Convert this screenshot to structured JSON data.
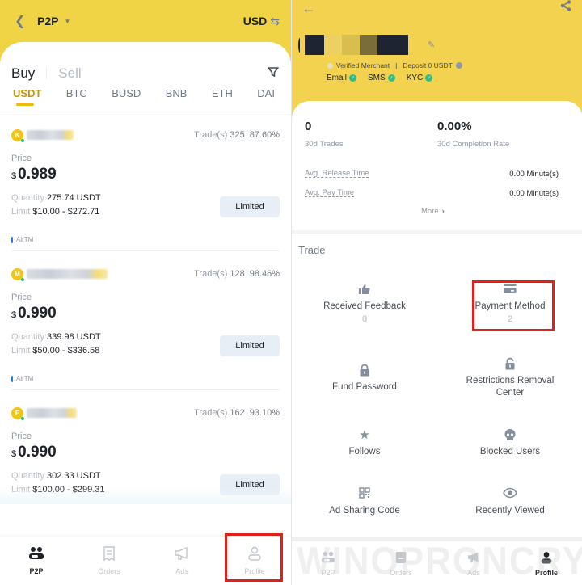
{
  "left": {
    "header": {
      "back_icon": "chevron-left-icon",
      "title": "P2P",
      "title_caret": "caret-down-icon",
      "currency": "USD",
      "swap_icon": "swap-icon"
    },
    "tabs": {
      "buy": "Buy",
      "sell": "Sell",
      "active": "Buy"
    },
    "filter_icon": "filter-icon",
    "coins": [
      "USDT",
      "BTC",
      "BUSD",
      "BNB",
      "ETH",
      "DAI"
    ],
    "active_coin": "USDT",
    "ads": [
      {
        "avatar_letter": "K",
        "trades_label": "Trade(s)",
        "trades": "325",
        "completion": "87.60%",
        "price_label": "Price",
        "currency_symbol": "$",
        "price": "0.989",
        "quantity_label": "Quantity",
        "quantity": "275.74 USDT",
        "limit_label": "Limit",
        "limit": "$10.00 - $272.71",
        "button": "Limited",
        "payment": "AirTM"
      },
      {
        "avatar_letter": "M",
        "trades_label": "Trade(s)",
        "trades": "128",
        "completion": "98.46%",
        "price_label": "Price",
        "currency_symbol": "$",
        "price": "0.990",
        "quantity_label": "Quantity",
        "quantity": "339.98 USDT",
        "limit_label": "Limit",
        "limit": "$50.00 - $336.58",
        "button": "Limited",
        "payment": "AirTM"
      },
      {
        "avatar_letter": "E",
        "trades_label": "Trade(s)",
        "trades": "162",
        "completion": "93.10%",
        "price_label": "Price",
        "currency_symbol": "$",
        "price": "0.990",
        "quantity_label": "Quantity",
        "quantity": "302.33 USDT",
        "limit_label": "Limit",
        "limit": "$100.00 - $299.31",
        "button": "Limited",
        "payment": "AirTM"
      }
    ],
    "bottom_nav": [
      {
        "label": "P2P",
        "icon": "p2p-icon",
        "active": true
      },
      {
        "label": "Orders",
        "icon": "orders-icon",
        "active": false
      },
      {
        "label": "Ads",
        "icon": "megaphone-icon",
        "active": false
      },
      {
        "label": "Profile",
        "icon": "profile-icon",
        "active": false,
        "highlighted": true
      }
    ]
  },
  "right": {
    "header": {
      "back_icon": "arrow-left-icon",
      "share_icon": "share-icon"
    },
    "profile": {
      "edit_icon": "edit-icon",
      "merchant_label": "Verified Merchant",
      "deposit_label": "Deposit 0 USDT",
      "verifications": [
        "Email",
        "SMS",
        "KYC"
      ]
    },
    "stats": {
      "trades_value": "0",
      "trades_label": "30d Trades",
      "completion_value": "0.00%",
      "completion_label": "30d Completion Rate",
      "release_label": "Avg. Release Time",
      "release_value": "0.00 Minute(s)",
      "pay_label": "Avg. Pay Time",
      "pay_value": "0.00 Minute(s)",
      "more": "More"
    },
    "trade_section": {
      "title": "Trade",
      "items": [
        {
          "label": "Received Feedback",
          "count": "0",
          "icon": "thumbs-up-icon"
        },
        {
          "label": "Payment Method",
          "count": "2",
          "icon": "card-icon",
          "highlighted": true
        },
        {
          "label": "Fund Password",
          "icon": "lock-icon"
        },
        {
          "label": "Restrictions Removal Center",
          "icon": "unlock-icon"
        },
        {
          "label": "Follows",
          "icon": "star-icon"
        },
        {
          "label": "Blocked Users",
          "icon": "blocked-user-icon"
        },
        {
          "label": "Ad Sharing Code",
          "icon": "qr-code-icon"
        },
        {
          "label": "Recently Viewed",
          "icon": "eye-icon"
        }
      ]
    },
    "bottom_nav": [
      {
        "label": "P2P",
        "icon": "p2p-icon",
        "active": false
      },
      {
        "label": "Orders",
        "icon": "orders-icon",
        "active": false
      },
      {
        "label": "Ads",
        "icon": "megaphone-icon",
        "active": false
      },
      {
        "label": "Profile",
        "icon": "profile-icon",
        "active": true
      }
    ],
    "watermark": "WINOPRONCRYPTO.COM"
  },
  "colors": {
    "brand_yellow": "#f0d445",
    "accent_gold": "#c99400",
    "success_green": "#2ebd85",
    "highlight_red": "#e0201a"
  }
}
